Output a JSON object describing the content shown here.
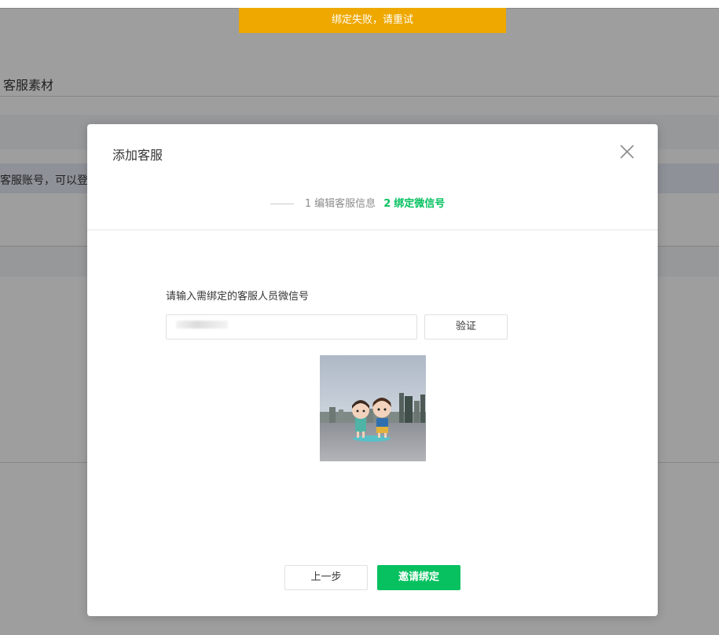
{
  "toast": {
    "text": "绑定失败，请重试",
    "color": "#eea800"
  },
  "background_page": {
    "section_title": "客服素材",
    "notice_text": "客服账号，可以登录"
  },
  "dialog": {
    "title": "添加客服",
    "close_icon": "close-icon",
    "steps": [
      {
        "number": "1",
        "label": "编辑客服信息",
        "state": "done"
      },
      {
        "number": "2",
        "label": "绑定微信号",
        "state": "active"
      }
    ],
    "field_label": "请输入需绑定的客服人员微信号",
    "wechat_input": {
      "value": "",
      "placeholder": ""
    },
    "verify_label": "验证",
    "avatar_icon": "avatar-image",
    "prev_label": "上一步",
    "invite_label": "邀请绑定",
    "accent_color": "#07c160"
  }
}
